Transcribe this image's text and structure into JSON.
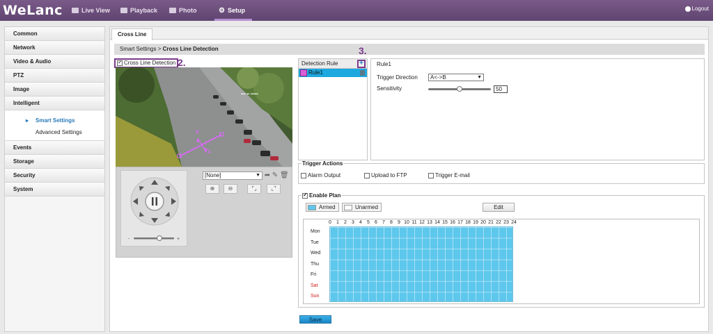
{
  "brand": "WeLanc",
  "nav": {
    "live_view": "Live View",
    "playback": "Playback",
    "photo": "Photo",
    "setup": "Setup",
    "logout": "Logout"
  },
  "menu": {
    "common": "Common",
    "network": "Network",
    "video_audio": "Video & Audio",
    "ptz": "PTZ",
    "image": "Image",
    "intelligent": "Intelligent",
    "smart_settings": "Smart Settings",
    "advanced_settings": "Advanced Settings",
    "events": "Events",
    "storage": "Storage",
    "security": "Security",
    "system": "System"
  },
  "tab": "Cross Line",
  "breadcrumb": {
    "parent": "Smart Settings",
    "sep": ">",
    "current": "Cross Line Detection"
  },
  "cross_line_detection": {
    "label": "Cross Line Detection",
    "checked": true
  },
  "annotations": {
    "step2": "2.",
    "step3": "3."
  },
  "video_overlay": {
    "a": "A",
    "b": "B"
  },
  "preset": {
    "value": "[None]",
    "arrow": "▼"
  },
  "rules": {
    "header": "Detection Rule",
    "add": "+",
    "items": [
      {
        "name": "Rule1",
        "color": "#d85fd8"
      }
    ]
  },
  "rule_detail": {
    "title": "Rule1",
    "trigger_direction_label": "Trigger Direction",
    "trigger_direction_value": "A<->B",
    "sensitivity_label": "Sensitivity",
    "sensitivity_value": "50",
    "sensitivity_max": 100
  },
  "trigger_actions": {
    "title": "Trigger Actions",
    "alarm_output": "Alarm Output",
    "upload_ftp": "Upload to FTP",
    "trigger_email": "Trigger E-mail"
  },
  "plan": {
    "title": "Enable Plan",
    "enabled": true,
    "armed": "Armed",
    "unarmed": "Unarmed",
    "edit": "Edit",
    "hours": [
      "0",
      "1",
      "2",
      "3",
      "4",
      "5",
      "6",
      "7",
      "8",
      "9",
      "10",
      "11",
      "12",
      "13",
      "14",
      "15",
      "16",
      "17",
      "18",
      "19",
      "20",
      "21",
      "22",
      "23",
      "24"
    ],
    "days": [
      "Mon",
      "Tue",
      "Wed",
      "Thu",
      "Fri",
      "Sat",
      "Sun"
    ],
    "armed_color": "#5ec7ec"
  },
  "save": "Save",
  "colors": {
    "header": "#6a4c7a",
    "accent": "#2a7ab8",
    "annotation": "#7a3a8a"
  }
}
